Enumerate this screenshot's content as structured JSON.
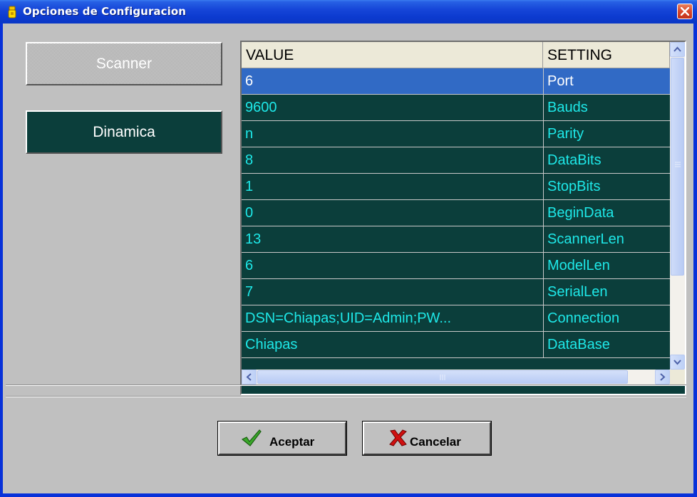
{
  "window": {
    "title": "Opciones de Configuracion",
    "icon": "yellow-app-icon",
    "close_icon": "close-icon"
  },
  "sidebar": {
    "items": [
      {
        "label": "Scanner",
        "selected": true
      },
      {
        "label": "Dinamica",
        "selected": false
      }
    ]
  },
  "grid": {
    "columns": [
      "VALUE",
      "SETTING"
    ],
    "rows": [
      {
        "value": "6",
        "setting": "Port",
        "selected": true
      },
      {
        "value": "9600",
        "setting": "Bauds"
      },
      {
        "value": "n",
        "setting": "Parity"
      },
      {
        "value": "8",
        "setting": "DataBits"
      },
      {
        "value": "1",
        "setting": "StopBits"
      },
      {
        "value": "0",
        "setting": "BeginData"
      },
      {
        "value": "13",
        "setting": "ScannerLen"
      },
      {
        "value": "6",
        "setting": "ModelLen"
      },
      {
        "value": "7",
        "setting": "SerialLen"
      },
      {
        "value": "DSN=Chiapas;UID=Admin;PW...",
        "setting": "Connection"
      },
      {
        "value": "Chiapas",
        "setting": "DataBase"
      }
    ]
  },
  "buttons": {
    "ok_label": "Aceptar",
    "ok_icon": "green-checkmark-icon",
    "cancel_label": "Cancelar",
    "cancel_icon": "red-x-icon"
  },
  "colors": {
    "grid_background": "#0b3e3b",
    "grid_text": "#1ee8e8",
    "selection": "#316ac5",
    "titlebar": "#0a37c6"
  }
}
